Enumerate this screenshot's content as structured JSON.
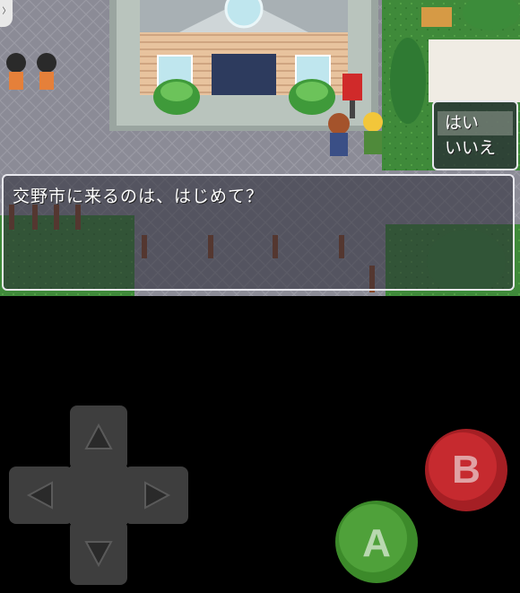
{
  "dialog": {
    "message": "交野市に来るのは、はじめて？"
  },
  "choices": [
    {
      "label": "はい",
      "selected": true
    },
    {
      "label": "いいえ",
      "selected": false
    }
  ],
  "controls": {
    "a_button": "A",
    "b_button": "B",
    "a_color": "#3c8a2a",
    "b_color": "#a51f24",
    "dpad_color": "#3e3e3e"
  },
  "icons": {
    "up": "arrow-up-icon",
    "down": "arrow-down-icon",
    "left": "arrow-left-icon",
    "right": "arrow-right-icon"
  }
}
